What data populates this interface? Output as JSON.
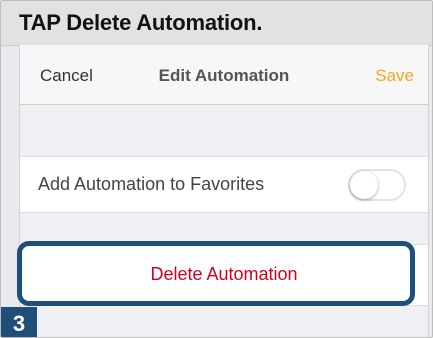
{
  "instruction": {
    "text": "TAP Delete Automation."
  },
  "navbar": {
    "cancel": "Cancel",
    "title": "Edit Automation",
    "save": "Save"
  },
  "favorites": {
    "label": "Add Automation to Favorites",
    "toggle_on": false
  },
  "delete": {
    "label": "Delete Automation"
  },
  "step": {
    "number": "3"
  },
  "colors": {
    "save": "#f5a623",
    "delete": "#d0021b",
    "highlight": "#1f4e79"
  }
}
